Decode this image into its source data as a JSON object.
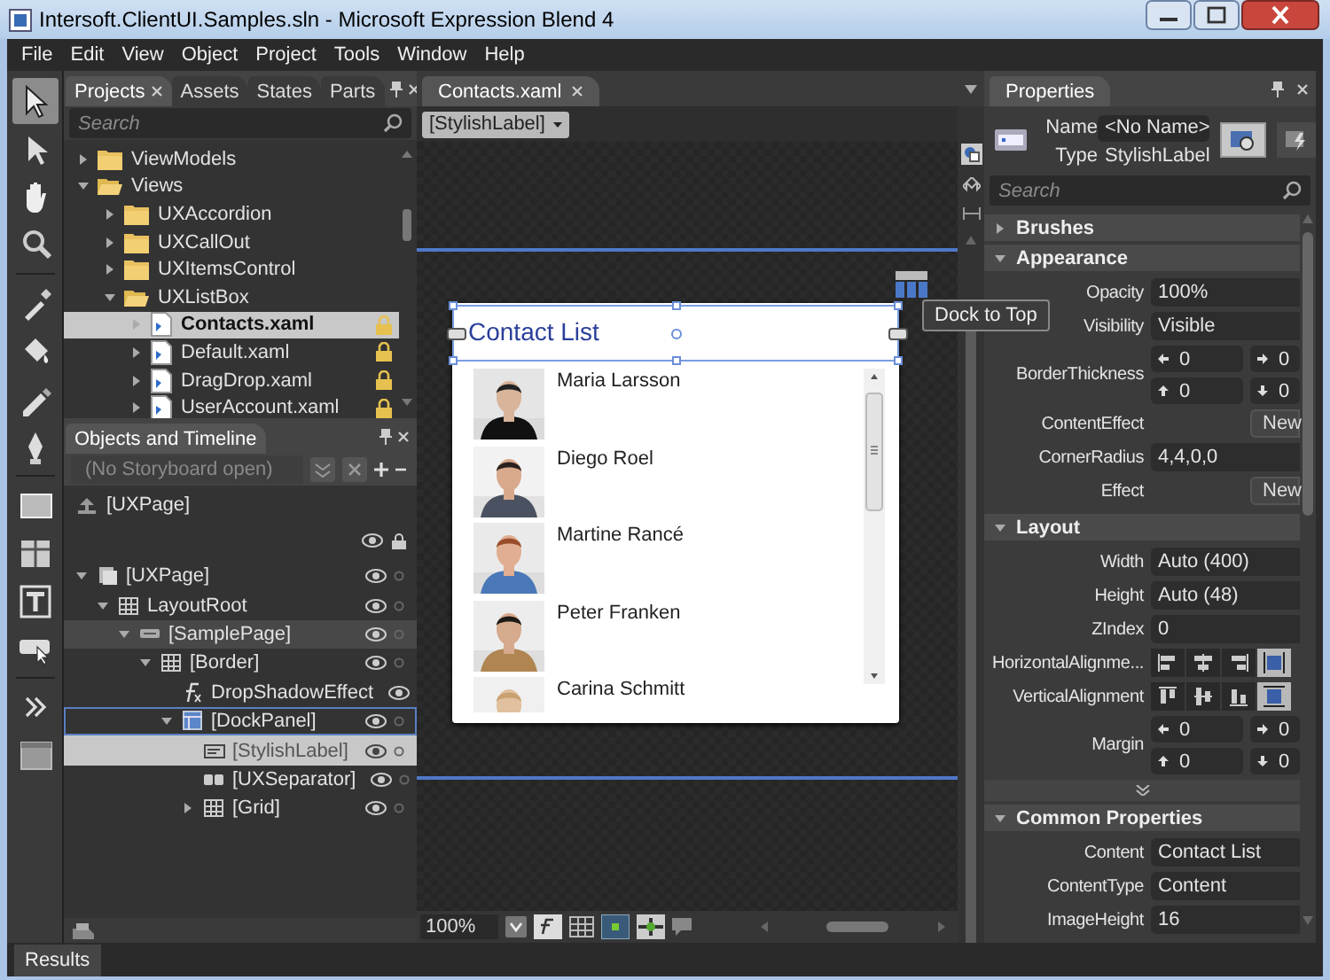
{
  "window": {
    "title": "Intersoft.ClientUI.Samples.sln - Microsoft Expression Blend 4"
  },
  "menu": [
    {
      "label": "File"
    },
    {
      "label": "Edit"
    },
    {
      "label": "View"
    },
    {
      "label": "Object"
    },
    {
      "label": "Project"
    },
    {
      "label": "Tools"
    },
    {
      "label": "Window"
    },
    {
      "label": "Help"
    }
  ],
  "toolbox": [
    {
      "kind": "selection",
      "selected": true
    },
    {
      "kind": "direct",
      "selected": false
    },
    {
      "kind": "pan",
      "selected": false
    },
    {
      "kind": "zoom",
      "selected": false
    },
    {
      "kind": "eyedropper",
      "selected": false
    },
    {
      "kind": "bucket",
      "selected": false
    },
    {
      "kind": "brush",
      "selected": false
    },
    {
      "kind": "pen",
      "selected": false
    },
    {
      "kind": "rectangle",
      "selected": false
    },
    {
      "kind": "grid",
      "selected": false
    },
    {
      "kind": "text",
      "selected": false
    },
    {
      "kind": "control",
      "selected": false
    },
    {
      "kind": "more",
      "selected": false
    },
    {
      "kind": "assets",
      "selected": false
    }
  ],
  "projects_panel": {
    "tabs": [
      {
        "label": "Projects",
        "selected": true
      },
      {
        "label": "Assets",
        "selected": false
      },
      {
        "label": "States",
        "selected": false
      },
      {
        "label": "Parts",
        "selected": false
      }
    ],
    "search": {
      "placeholder": "Search"
    },
    "tree": [
      {
        "label": "ViewModels",
        "kind": "folder",
        "expanded": false,
        "selected": false
      },
      {
        "label": "Views",
        "kind": "folder",
        "expanded": true,
        "selected": false,
        "children": [
          {
            "label": "UXAccordion",
            "kind": "folder",
            "expanded": false,
            "selected": false
          },
          {
            "label": "UXCallOut",
            "kind": "folder",
            "expanded": false,
            "selected": false
          },
          {
            "label": "UXItemsControl",
            "kind": "folder",
            "expanded": false,
            "selected": false
          },
          {
            "label": "UXListBox",
            "kind": "folder",
            "expanded": true,
            "selected": false,
            "children": [
              {
                "label": "Contacts.xaml",
                "kind": "file",
                "expanded": false,
                "selected": true,
                "locked": true
              },
              {
                "label": "Default.xaml",
                "kind": "file",
                "expanded": false,
                "selected": false,
                "locked": true
              },
              {
                "label": "DragDrop.xaml",
                "kind": "file",
                "expanded": false,
                "selected": false,
                "locked": true
              },
              {
                "label": "UserAccount.xaml",
                "kind": "file",
                "expanded": false,
                "selected": false,
                "locked": true
              }
            ]
          }
        ]
      }
    ]
  },
  "objects_panel": {
    "title": "Objects and Timeline",
    "storyboard": {
      "placeholder": "(No Storyboard open)"
    },
    "scope": "[UXPage]",
    "tree": [
      {
        "label": "[UXPage]",
        "kind": "page",
        "expandable": true,
        "expanded": true,
        "selected": false,
        "hovered": false,
        "focused": false,
        "children": [
          {
            "label": "LayoutRoot",
            "kind": "grid",
            "expandable": true,
            "expanded": true,
            "selected": false,
            "hovered": false,
            "focused": false,
            "children": [
              {
                "label": "[SamplePage]",
                "kind": "control",
                "expandable": true,
                "expanded": true,
                "selected": false,
                "hovered": true,
                "focused": false,
                "children": [
                  {
                    "label": "[Border]",
                    "kind": "grid",
                    "expandable": true,
                    "expanded": true,
                    "selected": false,
                    "hovered": false,
                    "focused": false,
                    "children": [
                      {
                        "label": "DropShadowEffect",
                        "kind": "effect",
                        "expandable": false,
                        "selected": false,
                        "hovered": false,
                        "focused": false
                      },
                      {
                        "label": "[DockPanel]",
                        "kind": "panel",
                        "expandable": true,
                        "expanded": true,
                        "selected": false,
                        "hovered": false,
                        "focused": true,
                        "children": [
                          {
                            "label": "[StylishLabel]",
                            "kind": "label",
                            "expandable": false,
                            "selected": true,
                            "hovered": false,
                            "focused": false
                          },
                          {
                            "label": "[UXSeparator]",
                            "kind": "separator",
                            "expandable": false,
                            "selected": false,
                            "hovered": false,
                            "focused": false
                          },
                          {
                            "label": "[Grid]",
                            "kind": "grid",
                            "expandable": true,
                            "expanded": false,
                            "selected": false,
                            "hovered": false,
                            "focused": false
                          }
                        ]
                      }
                    ]
                  }
                ]
              }
            ]
          }
        ]
      }
    ]
  },
  "document": {
    "tab": {
      "label": "Contacts.xaml",
      "selected": true
    },
    "breadcrumb": "[StylishLabel]",
    "card": {
      "header": "Contact List",
      "contacts": [
        {
          "name": "Maria Larsson"
        },
        {
          "name": "Diego Roel"
        },
        {
          "name": "Martine Rancé"
        },
        {
          "name": "Peter Franken"
        },
        {
          "name": "Carina Schmitt"
        }
      ]
    },
    "tooltip": "Dock to Top",
    "zoom": "100%"
  },
  "properties": {
    "title": "Properties",
    "name_label": "Name",
    "name_value": "<No Name>",
    "type_label": "Type",
    "type_value": "StylishLabel",
    "search": {
      "placeholder": "Search"
    },
    "sections": [
      {
        "title": "Brushes",
        "expanded": false
      },
      {
        "title": "Appearance",
        "expanded": true,
        "rows": [
          {
            "kind": "text",
            "label": "Opacity",
            "value": "100%"
          },
          {
            "kind": "text",
            "label": "Visibility",
            "value": "Visible"
          },
          {
            "kind": "quad",
            "label": "BorderThickness",
            "values": [
              "0",
              "0",
              "0",
              "0"
            ]
          },
          {
            "kind": "button",
            "label": "ContentEffect",
            "value": "New"
          },
          {
            "kind": "text",
            "label": "CornerRadius",
            "value": "4,4,0,0"
          },
          {
            "kind": "button",
            "label": "Effect",
            "value": "New"
          }
        ]
      },
      {
        "title": "Layout",
        "expanded": true,
        "more": true,
        "rows": [
          {
            "kind": "text",
            "label": "Width",
            "value": "Auto (400)"
          },
          {
            "kind": "text",
            "label": "Height",
            "value": "Auto (48)"
          },
          {
            "kind": "text",
            "label": "ZIndex",
            "value": "0"
          },
          {
            "kind": "halign",
            "label": "HorizontalAlignme...",
            "options": [
              {
                "selected": false
              },
              {
                "selected": false
              },
              {
                "selected": false
              },
              {
                "selected": true
              }
            ]
          },
          {
            "kind": "valign",
            "label": "VerticalAlignment",
            "options": [
              {
                "selected": false
              },
              {
                "selected": false
              },
              {
                "selected": false
              },
              {
                "selected": true
              }
            ]
          },
          {
            "kind": "quad",
            "label": "Margin",
            "values": [
              "0",
              "0",
              "0",
              "0"
            ]
          }
        ]
      },
      {
        "title": "Common Properties",
        "expanded": true,
        "rows": [
          {
            "kind": "text",
            "label": "Content",
            "value": "Contact List"
          },
          {
            "kind": "text",
            "label": "ContentType",
            "value": "Content"
          },
          {
            "kind": "text",
            "label": "ImageHeight",
            "value": "16"
          }
        ]
      }
    ]
  },
  "bottom_tabs": [
    {
      "label": "Results",
      "selected": true
    }
  ]
}
